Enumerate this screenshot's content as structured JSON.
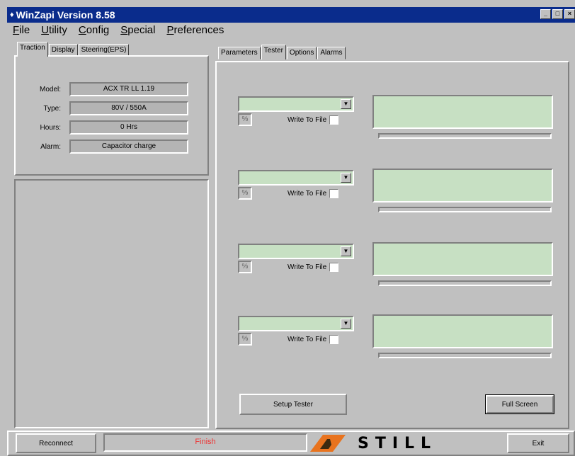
{
  "window": {
    "title": "WinZapi Version 8.58",
    "controls": [
      "minimize-icon",
      "maximize-icon",
      "close-icon"
    ]
  },
  "menu": [
    "File",
    "Utility",
    "Config",
    "Special",
    "Preferences"
  ],
  "left_tabs": {
    "items": [
      "Traction",
      "Display",
      "Steering(EPS)"
    ],
    "active": 0
  },
  "info": {
    "model_label": "Model:",
    "model_value": "ACX TR LL 1.19",
    "type_label": "Type:",
    "type_value": "80V / 550A",
    "hours_label": "Hours:",
    "hours_value": "0 Hrs",
    "alarm_label": "Alarm:",
    "alarm_value": "Capacitor charge"
  },
  "right_tabs": {
    "items": [
      "Parameters",
      "Tester",
      "Options",
      "Alarms"
    ],
    "active": 1
  },
  "tester": {
    "slots": [
      {
        "percent": "%",
        "write_label": "Write To File",
        "write_checked": false
      },
      {
        "percent": "%",
        "write_label": "Write To File",
        "write_checked": false
      },
      {
        "percent": "%",
        "write_label": "Write To File",
        "write_checked": false
      },
      {
        "percent": "%",
        "write_label": "Write To File",
        "write_checked": false
      }
    ],
    "setup_button": "Setup Tester",
    "fullscreen_button": "Full Screen"
  },
  "status": {
    "reconnect_button": "Reconnect",
    "status_text": "Finish",
    "brand": "STILL",
    "exit_button": "Exit"
  },
  "colors": {
    "lcd": "#c7e0c3",
    "titlebar": "#0a2c8c",
    "status_text": "#e33333",
    "logo_orange": "#e8731e"
  }
}
